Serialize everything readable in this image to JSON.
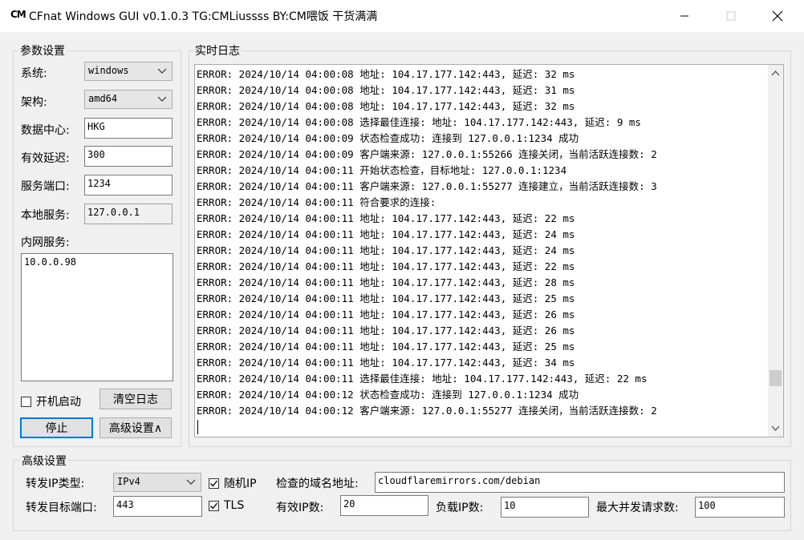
{
  "window": {
    "logo": "CM",
    "title": "CFnat Windows GUI v0.1.0.3 TG:CMLiussss BY:CM喂饭 干货满满"
  },
  "params": {
    "group_title": "参数设置",
    "system_label": "系统:",
    "system_value": "windows",
    "arch_label": "架构:",
    "arch_value": "amd64",
    "datacenter_label": "数据中心:",
    "datacenter_value": "HKG",
    "delay_label": "有效延迟:",
    "delay_value": "300",
    "port_label": "服务端口:",
    "port_value": "1234",
    "local_label": "本地服务:",
    "local_value": "127.0.0.1",
    "lan_label": "内网服务:",
    "lan_value": "10.0.0.98",
    "autostart_label": "开机启动",
    "clear_log_label": "清空日志",
    "stop_label": "停止",
    "advanced_label": "高级设置∧"
  },
  "log": {
    "group_title": "实时日志",
    "lines": [
      "ERROR: 2024/10/14 04:00:08 地址: 104.17.177.142:443, 延迟: 32 ms",
      "ERROR: 2024/10/14 04:00:08 地址: 104.17.177.142:443, 延迟: 31 ms",
      "ERROR: 2024/10/14 04:00:08 地址: 104.17.177.142:443, 延迟: 32 ms",
      "ERROR: 2024/10/14 04:00:08 选择最佳连接: 地址: 104.17.177.142:443, 延迟: 9 ms",
      "ERROR: 2024/10/14 04:00:09 状态检查成功: 连接到 127.0.0.1:1234 成功",
      "ERROR: 2024/10/14 04:00:09 客户端来源: 127.0.0.1:55266 连接关闭，当前活跃连接数: 2",
      "ERROR: 2024/10/14 04:00:11 开始状态检查，目标地址: 127.0.0.1:1234",
      "ERROR: 2024/10/14 04:00:11 客户端来源: 127.0.0.1:55277 连接建立，当前活跃连接数: 3",
      "ERROR: 2024/10/14 04:00:11 符合要求的连接:",
      "ERROR: 2024/10/14 04:00:11 地址: 104.17.177.142:443, 延迟: 22 ms",
      "ERROR: 2024/10/14 04:00:11 地址: 104.17.177.142:443, 延迟: 24 ms",
      "ERROR: 2024/10/14 04:00:11 地址: 104.17.177.142:443, 延迟: 24 ms",
      "ERROR: 2024/10/14 04:00:11 地址: 104.17.177.142:443, 延迟: 22 ms",
      "ERROR: 2024/10/14 04:00:11 地址: 104.17.177.142:443, 延迟: 28 ms",
      "ERROR: 2024/10/14 04:00:11 地址: 104.17.177.142:443, 延迟: 25 ms",
      "ERROR: 2024/10/14 04:00:11 地址: 104.17.177.142:443, 延迟: 26 ms",
      "ERROR: 2024/10/14 04:00:11 地址: 104.17.177.142:443, 延迟: 26 ms",
      "ERROR: 2024/10/14 04:00:11 地址: 104.17.177.142:443, 延迟: 25 ms",
      "ERROR: 2024/10/14 04:00:11 地址: 104.17.177.142:443, 延迟: 34 ms",
      "ERROR: 2024/10/14 04:00:11 选择最佳连接: 地址: 104.17.177.142:443, 延迟: 22 ms",
      "ERROR: 2024/10/14 04:00:12 状态检查成功: 连接到 127.0.0.1:1234 成功",
      "ERROR: 2024/10/14 04:00:12 客户端来源: 127.0.0.1:55277 连接关闭，当前活跃连接数: 2"
    ],
    "scroll_position": 0.94
  },
  "advanced": {
    "group_title": "高级设置",
    "ip_type_label": "转发IP类型:",
    "ip_type_value": "IPv4",
    "random_ip_label": "随机IP",
    "domain_label": "检查的域名地址:",
    "domain_value": "cloudflaremirrors.com/debian",
    "target_port_label": "转发目标端口:",
    "target_port_value": "443",
    "tls_label": "TLS",
    "valid_ip_label": "有效IP数:",
    "valid_ip_value": "20",
    "load_ip_label": "负载IP数:",
    "load_ip_value": "10",
    "max_concurrent_label": "最大并发请求数:",
    "max_concurrent_value": "100"
  }
}
